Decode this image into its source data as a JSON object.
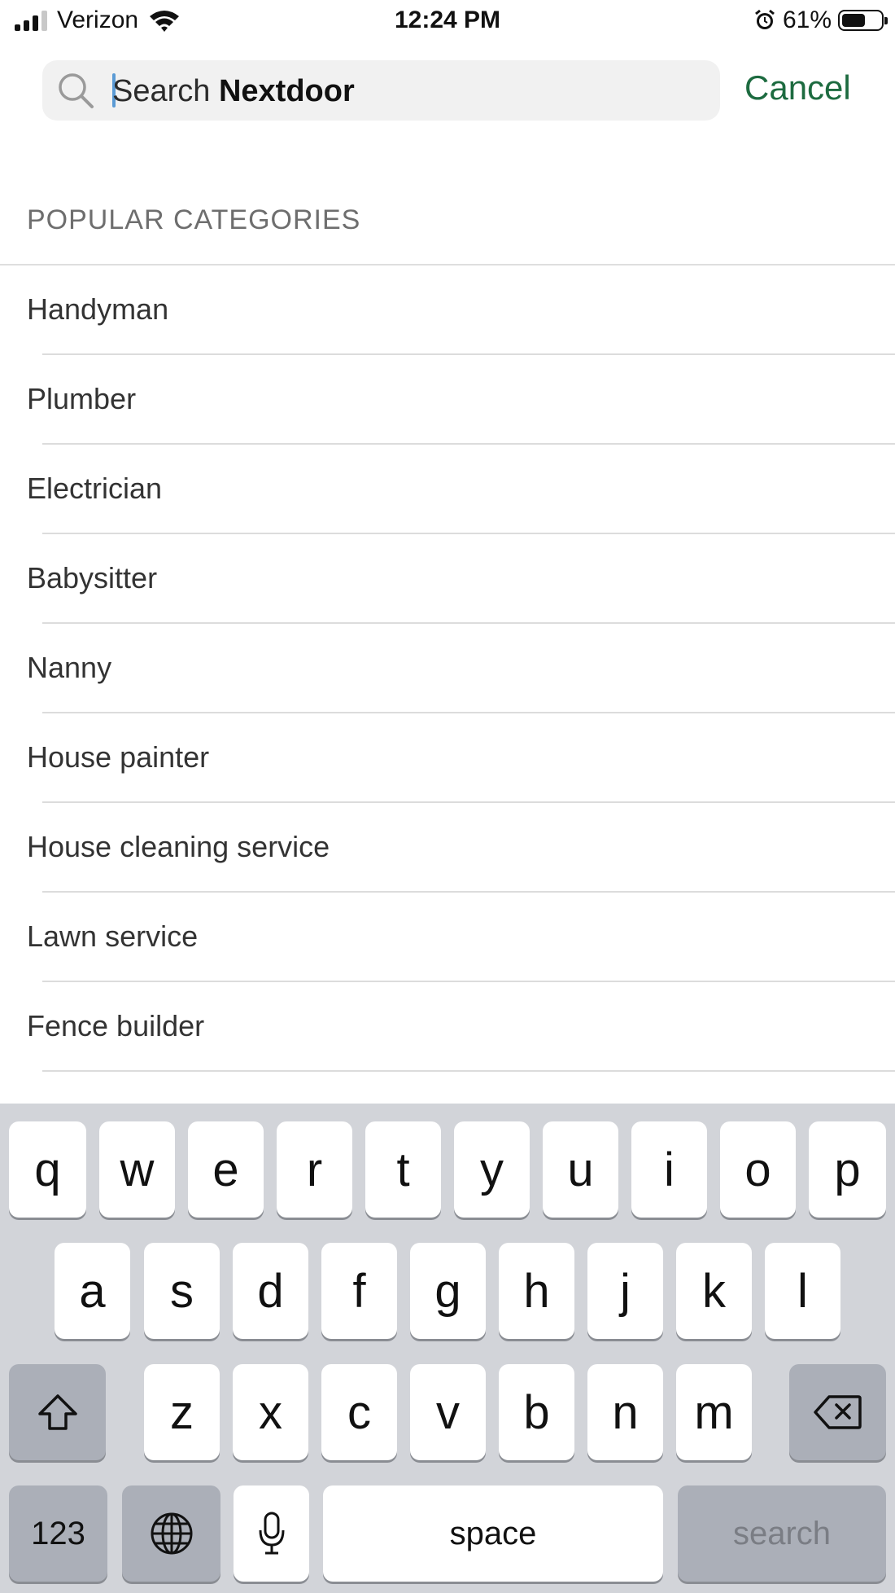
{
  "status_bar": {
    "carrier": "Verizon",
    "time": "12:24 PM",
    "battery_percent": "61%",
    "battery_level": 0.61,
    "signal_bars_active": 3,
    "icons": [
      "signal-icon",
      "wifi-icon",
      "alarm-icon",
      "battery-icon"
    ]
  },
  "search": {
    "placeholder_prefix": "Search ",
    "placeholder_brand": "Nextdoor",
    "cancel_label": "Cancel",
    "icon": "search-icon"
  },
  "colors": {
    "accent": "#1d6b40",
    "caret": "#5b9bd5",
    "keyboard_bg": "#d2d4d9"
  },
  "categories": {
    "header": "POPULAR CATEGORIES",
    "items": [
      {
        "label": "Handyman"
      },
      {
        "label": "Plumber"
      },
      {
        "label": "Electrician"
      },
      {
        "label": "Babysitter"
      },
      {
        "label": "Nanny"
      },
      {
        "label": "House painter"
      },
      {
        "label": "House cleaning service"
      },
      {
        "label": "Lawn service"
      },
      {
        "label": "Fence builder"
      }
    ]
  },
  "keyboard": {
    "row1": [
      "q",
      "w",
      "e",
      "r",
      "t",
      "y",
      "u",
      "i",
      "o",
      "p"
    ],
    "row2": [
      "a",
      "s",
      "d",
      "f",
      "g",
      "h",
      "j",
      "k",
      "l"
    ],
    "row3": [
      "z",
      "x",
      "c",
      "v",
      "b",
      "n",
      "m"
    ],
    "numbers_label": "123",
    "space_label": "space",
    "search_label": "search",
    "icons": [
      "shift-icon",
      "delete-icon",
      "globe-icon",
      "microphone-icon"
    ]
  }
}
